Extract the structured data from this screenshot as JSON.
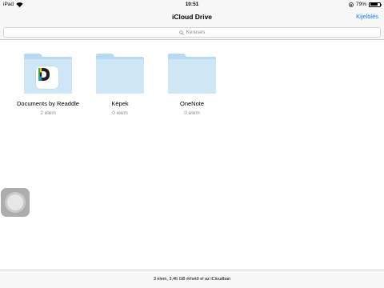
{
  "status_bar": {
    "device": "iPad",
    "time": "10:51",
    "battery": "79%",
    "battery_level": 0.79
  },
  "nav": {
    "title": "iCloud Drive",
    "action_label": "Kijelölés"
  },
  "search": {
    "placeholder": "Keresés"
  },
  "files": [
    {
      "name": "Documents by Readdle",
      "count": "2 elem",
      "icon": "folder-with-app-icon"
    },
    {
      "name": "Képek",
      "count": "0 elem",
      "icon": "folder-icon"
    },
    {
      "name": "OneNote",
      "count": "0 elem",
      "icon": "folder-icon"
    }
  ],
  "footer": {
    "text": "3 elem, 3,46 GB érhető el az iCloudban"
  },
  "colors": {
    "accent": "#0a7afe",
    "folder_back": "#b8d9f2",
    "folder_front": "#cfe6f7",
    "bar_background": "#f7f7f7"
  }
}
